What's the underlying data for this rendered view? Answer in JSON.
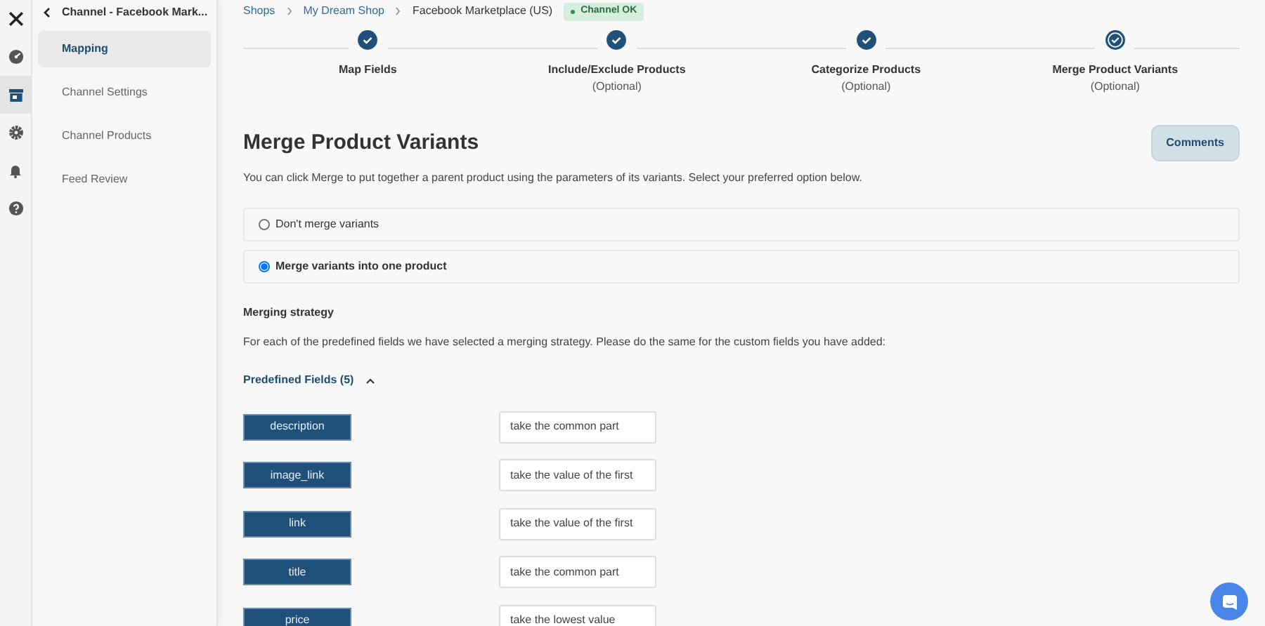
{
  "rail": [
    {
      "selected": false
    },
    {
      "selected": false
    },
    {
      "selected": true
    },
    {
      "selected": false
    },
    {
      "selected": false
    },
    {
      "selected": false
    }
  ],
  "sidebar": {
    "title": "Channel - Facebook Mark...",
    "items": [
      {
        "label": "Mapping",
        "selected": true
      },
      {
        "label": "Channel Settings",
        "selected": false
      },
      {
        "label": "Channel Products",
        "selected": false
      },
      {
        "label": "Feed Review",
        "selected": false
      }
    ]
  },
  "breadcrumb": {
    "links": [
      "Shops",
      "My Dream Shop"
    ],
    "current": "Facebook Marketplace (US)",
    "status": "Channel OK"
  },
  "steps": [
    {
      "label": "Map Fields",
      "current": false
    },
    {
      "label": "Include/Exclude Products",
      "sub": "(Optional)",
      "current": false
    },
    {
      "label": "Categorize Products",
      "sub": "(Optional)",
      "current": false
    },
    {
      "label": "Merge Product Variants",
      "sub": "(Optional)",
      "current": true
    }
  ],
  "heading": "Merge Product Variants",
  "comments_button": "Comments",
  "intro": "You can click Merge to put together a parent product using the parameters of its variants. Select your preferred option below.",
  "options": [
    {
      "label": "Don't merge variants",
      "selected": false
    },
    {
      "label": "Merge variants into one product",
      "selected": true
    }
  ],
  "strategy": {
    "title": "Merging strategy",
    "text": "For each of the predefined fields we have selected a merging strategy. Please do the same for the custom fields you have added:",
    "toggle": "Predefined Fields (5)",
    "expanded": true
  },
  "fields": [
    {
      "name": "description",
      "value": "take the common part"
    },
    {
      "name": "image_link",
      "value": "take the value of the first"
    },
    {
      "name": "link",
      "value": "take the value of the first"
    },
    {
      "name": "title",
      "value": "take the common part"
    },
    {
      "name": "price",
      "value": "take the lowest value"
    }
  ]
}
